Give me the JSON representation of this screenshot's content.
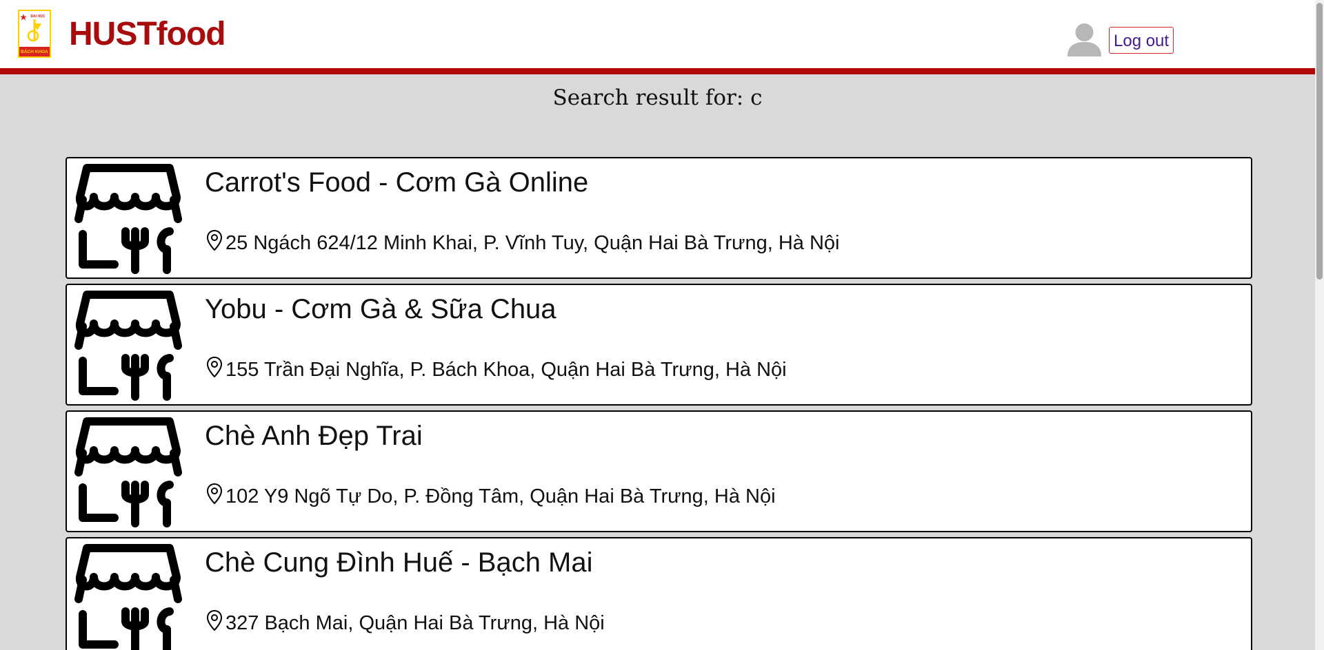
{
  "header": {
    "brand": "HUSTfood",
    "logo_text_top": "ĐẠI HỌC",
    "logo_text_bottom": "BÁCH KHOA",
    "logout_label": "Log out"
  },
  "search": {
    "title": "Search result for: c"
  },
  "results": [
    {
      "name": "Carrot's Food - Cơm Gà Online",
      "address": "25 Ngách 624/12 Minh Khai, P. Vĩnh Tuy, Quận Hai Bà Trưng, Hà Nội"
    },
    {
      "name": "Yobu - Cơm Gà & Sữa Chua",
      "address": "155 Trần Đại Nghĩa, P. Bách Khoa, Quận Hai Bà Trưng, Hà Nội"
    },
    {
      "name": "Chè Anh Đẹp Trai",
      "address": "102 Y9 Ngõ Tự Do, P. Đồng Tâm, Quận Hai Bà Trưng, Hà Nội"
    },
    {
      "name": "Chè Cung Đình Huế - Bạch Mai",
      "address": "327 Bạch Mai, Quận Hai Bà Trưng, Hà Nội"
    }
  ],
  "icons": {
    "logo": "bach-khoa-logo-icon",
    "avatar": "user-avatar-icon",
    "shop": "store-utensils-icon",
    "pin": "location-pin-icon"
  },
  "colors": {
    "brand_red": "#a80c0c",
    "header_bar": "#b20606",
    "logout_border": "#d42525",
    "logout_text": "#401a8c",
    "page_bg": "#d9d9d9"
  }
}
